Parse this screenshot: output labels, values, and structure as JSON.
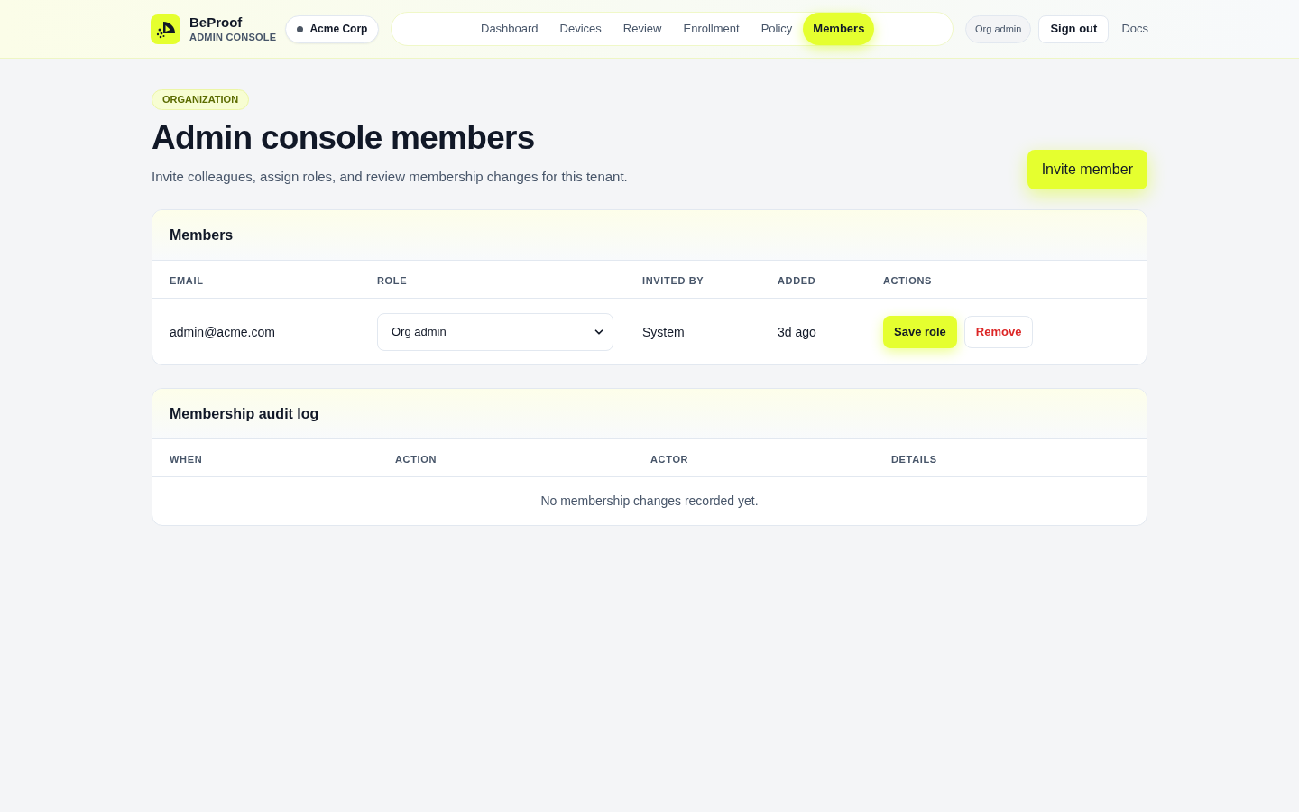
{
  "brand": {
    "name": "BeProof",
    "subtitle": "ADMIN CONSOLE"
  },
  "tenant": {
    "name": "Acme Corp"
  },
  "nav": [
    {
      "label": "Dashboard",
      "selected": false
    },
    {
      "label": "Devices",
      "selected": false
    },
    {
      "label": "Review",
      "selected": false
    },
    {
      "label": "Enrollment",
      "selected": false
    },
    {
      "label": "Policy",
      "selected": false
    },
    {
      "label": "Members",
      "selected": true
    }
  ],
  "role_badge": "Org admin",
  "sign_out": "Sign out",
  "docs": "Docs",
  "page": {
    "eyebrow": "ORGANIZATION",
    "title": "Admin console members",
    "description": "Invite colleagues, assign roles, and review membership changes for this tenant.",
    "primary_action": "Invite member"
  },
  "members_table": {
    "title": "Members",
    "columns": [
      "EMAIL",
      "ROLE",
      "INVITED BY",
      "ADDED",
      "ACTIONS"
    ],
    "rows": [
      {
        "email": "admin@acme.com",
        "role": "Org admin",
        "invited_by": "System",
        "added": "3d ago",
        "actions": [
          {
            "label": "Save role",
            "kind": "primary"
          },
          {
            "label": "Remove",
            "kind": "danger"
          }
        ]
      }
    ]
  },
  "audit_log": {
    "title": "Membership audit log",
    "columns": [
      "WHEN",
      "ACTION",
      "ACTOR",
      "DETAILS"
    ],
    "empty_message": "No membership changes recorded yet."
  }
}
